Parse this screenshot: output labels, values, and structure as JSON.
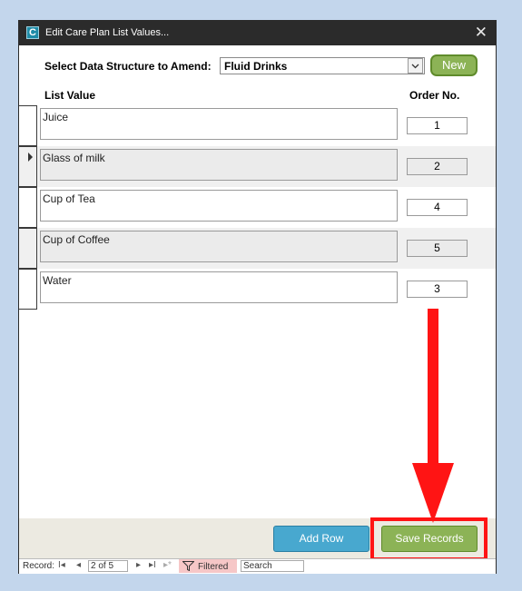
{
  "window": {
    "title": "Edit Care Plan List Values...",
    "app_icon": "C",
    "close_glyph": "✕"
  },
  "selector": {
    "label": "Select Data Structure to Amend:",
    "value": "Fluid Drinks",
    "new_button": "New"
  },
  "columns": {
    "list_value": "List Value",
    "order_no": "Order No."
  },
  "rows": [
    {
      "value": "Juice",
      "order": "1"
    },
    {
      "value": "Glass of milk",
      "order": "2"
    },
    {
      "value": "Cup of Tea",
      "order": "4"
    },
    {
      "value": "Cup of Coffee",
      "order": "5"
    },
    {
      "value": "Water",
      "order": "3"
    }
  ],
  "buttons": {
    "add_row": "Add Row",
    "save_records": "Save Records"
  },
  "navigation": {
    "label": "Record:",
    "first": "I◂",
    "prev": "◂",
    "position": "2 of 5",
    "next": "▸",
    "last": "▸I",
    "new": "▸*",
    "filtered": "Filtered",
    "search": "Search"
  },
  "colors": {
    "accent_green": "#8cb356",
    "accent_blue": "#48a8cf",
    "highlight_red": "#ff1414",
    "background": "#c3d6ec"
  }
}
